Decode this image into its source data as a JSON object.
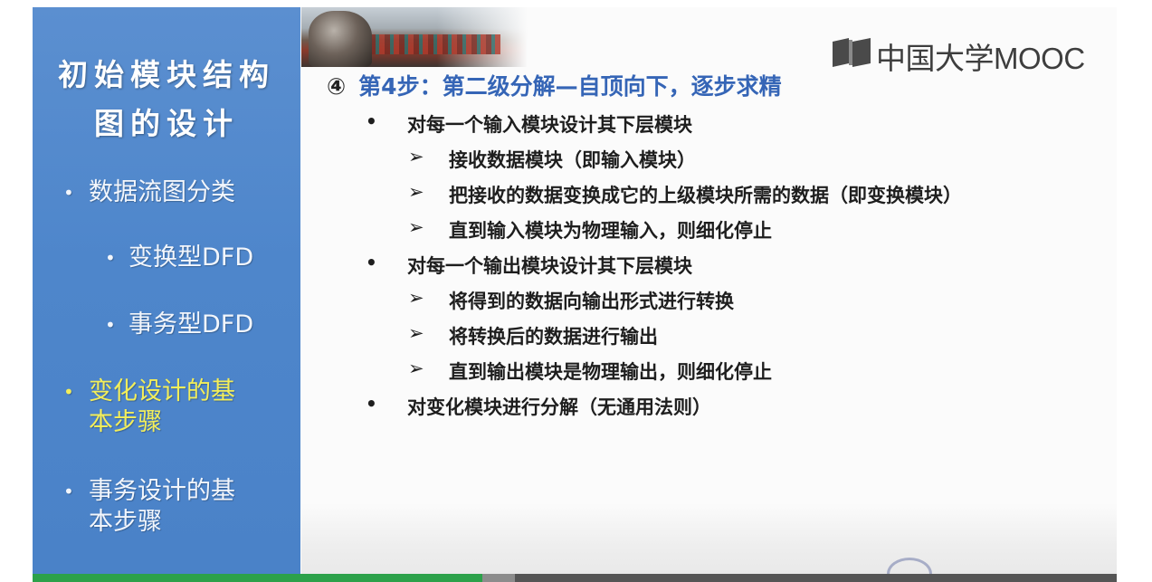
{
  "sidebar": {
    "title_line1": "初始模块结构",
    "title_line2": "图的设计",
    "items": [
      {
        "bullet": "•",
        "label": "数据流图分类"
      },
      {
        "bullet": "•",
        "label": "变换型DFD"
      },
      {
        "bullet": "•",
        "label": "事务型DFD"
      },
      {
        "bullet": "•",
        "label_line1": "变化设计的基",
        "label_line2": "本步骤"
      },
      {
        "bullet": "•",
        "label_line1": "事务设计的基",
        "label_line2": "本步骤"
      }
    ]
  },
  "logo": {
    "text": "中国大学MOOC"
  },
  "heading": {
    "number": "④",
    "text": "第4步：第二级分解—自顶向下，逐步求精"
  },
  "content": {
    "section1": {
      "bullet": "•",
      "text": "对每一个输入模块设计其下层模块",
      "items": [
        {
          "mark": "➢",
          "text": "接收数据模块（即输入模块）"
        },
        {
          "mark": "➢",
          "text": "把接收的数据变换成它的上级模块所需的数据（即变换模块）"
        },
        {
          "mark": "➢",
          "text": "直到输入模块为物理输入，则细化停止"
        }
      ]
    },
    "section2": {
      "bullet": "•",
      "text": "对每一个输出模块设计其下层模块",
      "items": [
        {
          "mark": "➢",
          "text": "将得到的数据向输出形式进行转换"
        },
        {
          "mark": "➢",
          "text": "将转换后的数据进行输出"
        },
        {
          "mark": "➢",
          "text": "直到输出模块是物理输出，则细化停止"
        }
      ]
    },
    "section3": {
      "bullet": "•",
      "text": "对变化模块进行分解（无通用法则）"
    }
  },
  "player": {
    "played_fraction": 0.415,
    "buffered_fraction": 0.445
  },
  "colors": {
    "sidebar_bg": "#4e86cb",
    "active_item": "#f3ee5a",
    "heading_accent": "#3565b6",
    "progress_played": "#2ca14a"
  }
}
